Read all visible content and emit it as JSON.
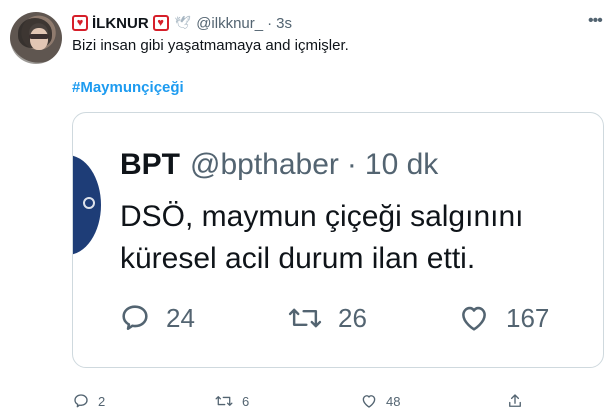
{
  "author": {
    "display_name": "İLKNUR",
    "handle": "@ilkknur_",
    "separator": "·",
    "time": "3s"
  },
  "tweet": {
    "text": "Bizi insan gibi yaşatmamaya and içmişler.",
    "hashtag": "#Maymunçiçeği"
  },
  "quoted_tweet": {
    "display_name": "BPT",
    "handle": "@bpthaber",
    "separator": "·",
    "time": "10 dk",
    "text": "DSÖ, maymun çiçeği salgınını küresel acil durum ilan etti.",
    "reply_count": "24",
    "retweet_count": "26",
    "like_count": "167"
  },
  "actions": {
    "reply_count": "2",
    "retweet_count": "6",
    "like_count": "48"
  },
  "colors": {
    "accent": "#1d9bf0",
    "badge_red": "#d61f2a",
    "muted_text": "#536471"
  },
  "icons": [
    "heart-badge-icon",
    "dove-icon",
    "more-icon",
    "reply-icon",
    "retweet-icon",
    "like-icon",
    "share-icon"
  ]
}
